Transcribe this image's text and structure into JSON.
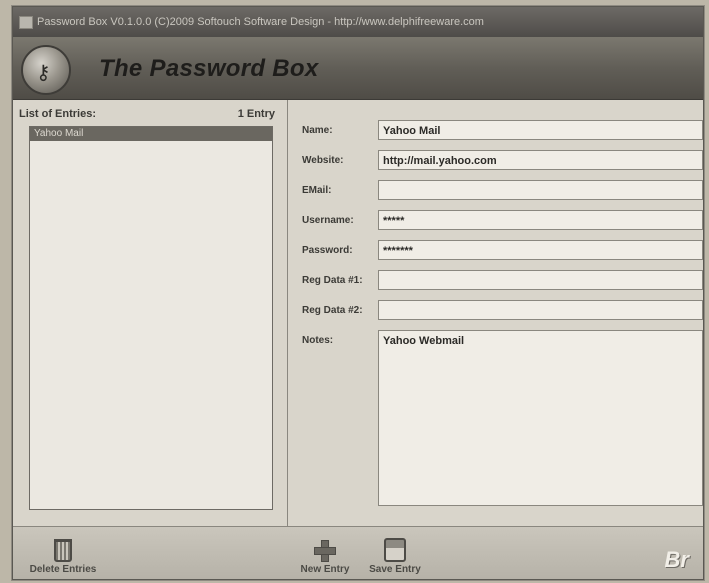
{
  "window": {
    "title": "Password Box V0.1.0.0 (C)2009 Softouch Software Design - http://www.delphifreeware.com"
  },
  "banner": {
    "title": "The Password Box"
  },
  "list": {
    "header": "List of Entries:",
    "count": "1 Entry",
    "items": [
      "Yahoo Mail"
    ]
  },
  "form": {
    "name_label": "Name:",
    "name_value": "Yahoo Mail",
    "website_label": "Website:",
    "website_value": "http://mail.yahoo.com",
    "email_label": "EMail:",
    "email_value": "",
    "username_label": "Username:",
    "username_value": "*****",
    "password_label": "Password:",
    "password_value": "*******",
    "reg1_label": "Reg Data #1:",
    "reg1_value": "",
    "reg2_label": "Reg Data #2:",
    "reg2_value": "",
    "notes_label": "Notes:",
    "notes_value": "Yahoo Webmail"
  },
  "toolbar": {
    "delete_label": "Delete Entries",
    "new_label": "New Entry",
    "save_label": "Save Entry"
  },
  "watermark": {
    "text": "Br"
  },
  "icons": {
    "app": "key-icon",
    "delete": "trash-icon",
    "new": "plus-icon",
    "save": "disk-icon"
  }
}
